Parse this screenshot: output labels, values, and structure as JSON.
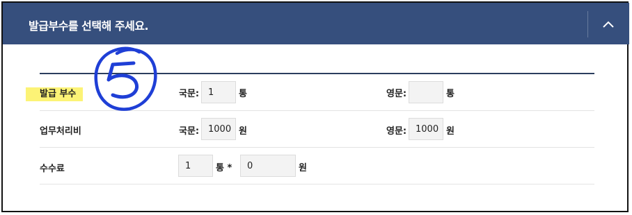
{
  "header": {
    "title": "발급부수를 선택해 주세요.",
    "toggle_icon": "chevron-up-icon"
  },
  "annotation": {
    "handwritten_mark": "5"
  },
  "rows": [
    {
      "label": "발급 부수",
      "highlighted": true,
      "korean": {
        "label": "국문:",
        "value": "1",
        "unit": "통"
      },
      "english": {
        "label": "영문:",
        "value": "",
        "unit": "통"
      }
    },
    {
      "label": "업무처리비",
      "highlighted": false,
      "korean": {
        "label": "국문:",
        "value": "1000",
        "unit": "원"
      },
      "english": {
        "label": "영문:",
        "value": "1000",
        "unit": "원"
      }
    },
    {
      "label": "수수료",
      "count": {
        "value": "1",
        "unit": "통 *"
      },
      "fee": {
        "value": "0",
        "unit": "원"
      }
    }
  ],
  "colors": {
    "header_bg": "#364f7d",
    "highlight": "#fcf376",
    "annotation_ink": "#1f3fd6"
  }
}
